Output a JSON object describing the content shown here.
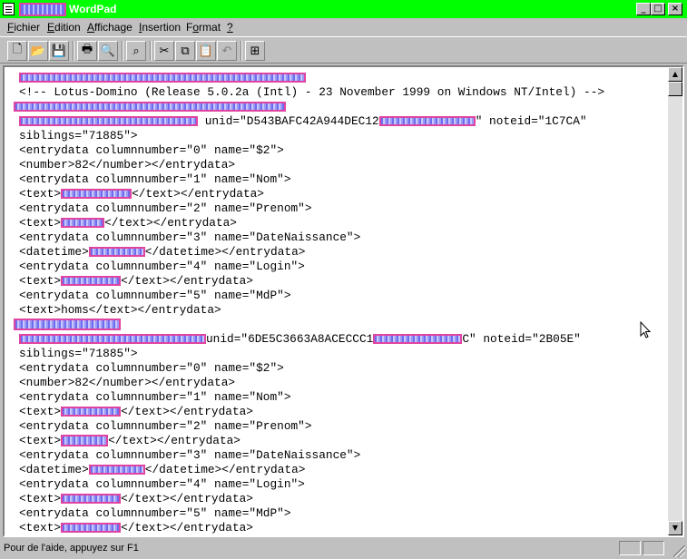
{
  "window": {
    "title": "WordPad"
  },
  "menu": [
    {
      "label": "Fichier",
      "u": "F",
      "rest": "ichier"
    },
    {
      "label": "Edition",
      "u": "E",
      "rest": "dition"
    },
    {
      "label": "Affichage",
      "u": "A",
      "rest": "ffichage"
    },
    {
      "label": "Insertion",
      "u": "I",
      "rest": "nsertion"
    },
    {
      "label": "Format",
      "u": "o",
      "pre": "F",
      "rest": "rmat"
    },
    {
      "label": "?",
      "u": "?",
      "rest": ""
    }
  ],
  "toolbar": {
    "icons": [
      "new-icon",
      "open-icon",
      "save-icon",
      "print-icon",
      "print-preview-icon",
      "find-icon",
      "cut-icon",
      "copy-icon",
      "paste-icon",
      "undo-icon",
      "insert-object-icon"
    ]
  },
  "document": {
    "lines": [
      "",
      "<!-- Lotus-Domino (Release 5.0.2a (Intl) - 23 November 1999 on Windows NT/Intel) -->",
      "",
      "unid=\"D543BAFC42A944DEC12",
      "siblings=\"71885\">",
      "<entrydata columnnumber=\"0\" name=\"$2\">",
      "<number>82</number></entrydata>",
      "<entrydata columnnumber=\"1\" name=\"Nom\">",
      "</text></entrydata>",
      "<entrydata columnnumber=\"2\" name=\"Prenom\">",
      "</text></entrydata>",
      "<entrydata columnnumber=\"3\" name=\"DateNaissance\">",
      "</datetime></entrydata>",
      "<entrydata columnnumber=\"4\" name=\"Login\">",
      "</text></entrydata>",
      "<entrydata columnnumber=\"5\" name=\"MdP\">",
      "<text>homs</text></entrydata>",
      "",
      "unid=\"6DE5C3663A8ACECCC1",
      "siblings=\"71885\">",
      "<entrydata columnnumber=\"0\" name=\"$2\">",
      "<number>82</number></entrydata>",
      "<entrydata columnnumber=\"1\" name=\"Nom\">",
      "</text></entrydata>",
      "<entrydata columnnumber=\"2\" name=\"Prenom\">",
      "</text></entrydata>",
      "<entrydata columnnumber=\"3\" name=\"DateNaissance\">",
      "</datetime></entrydata>",
      "<entrydata columnnumber=\"4\" name=\"Login\">",
      "</text></entrydata>",
      "<entrydata columnnumber=\"5\" name=\"MdP\">",
      "</text></entrydata>"
    ],
    "open_text": "<text>",
    "open_datetime": "<datetime>",
    "noteid_1_prefix": "\" noteid=\"1C7CA\"",
    "noteid_2_prefix": "C\" noteid=\"2B05E\""
  },
  "status": {
    "text": "Pour de l'aide, appuyez sur F1"
  },
  "colors": {
    "titlebar": "#00ff00",
    "redaction_border": "#e044a0",
    "redaction_fill": "#6d6df0"
  }
}
